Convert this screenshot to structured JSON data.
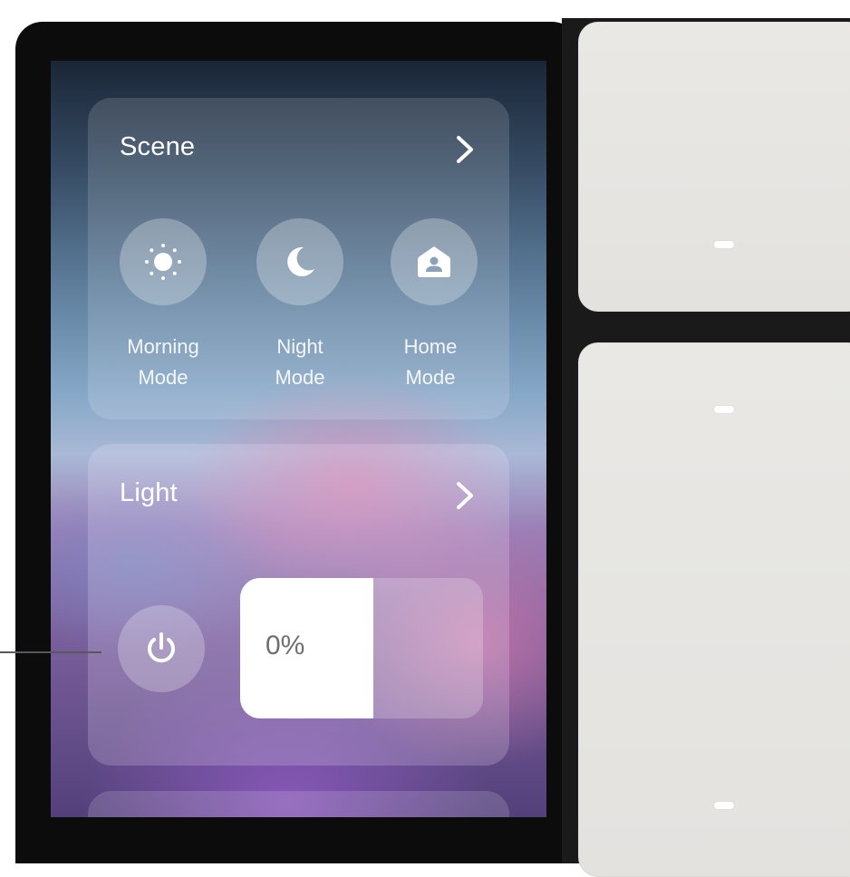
{
  "scene": {
    "title": "Scene",
    "modes": [
      {
        "line1": "Morning",
        "line2": "Mode",
        "icon": "sun-icon"
      },
      {
        "line1": "Night",
        "line2": "Mode",
        "icon": "moon-icon"
      },
      {
        "line1": "Home",
        "line2": "Mode",
        "icon": "home-person-icon"
      }
    ]
  },
  "light": {
    "title": "Light",
    "brightness_label": "0%",
    "brightness_value": 0
  },
  "colors": {
    "card_text": "#ffffff",
    "slider_fill": "#ffffff",
    "switch_panel": "#e6e5e2",
    "bezel": "#0c0c0d"
  }
}
